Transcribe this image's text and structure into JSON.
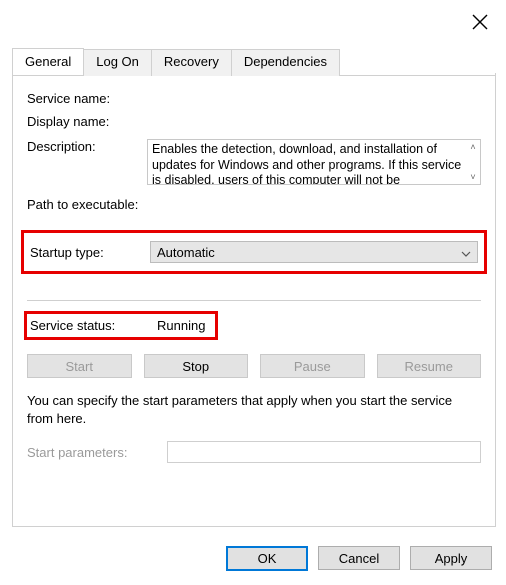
{
  "tabs": {
    "general": "General",
    "logon": "Log On",
    "recovery": "Recovery",
    "dependencies": "Dependencies"
  },
  "labels": {
    "service_name": "Service name:",
    "display_name": "Display name:",
    "description": "Description:",
    "path": "Path to executable:",
    "startup_type": "Startup type:",
    "service_status": "Service status:",
    "start_params": "Start parameters:"
  },
  "values": {
    "description": "Enables the detection, download, and installation of updates for Windows and other programs. If this service is disabled, users of this computer will not be",
    "startup_type": "Automatic",
    "service_status": "Running"
  },
  "buttons": {
    "start": "Start",
    "stop": "Stop",
    "pause": "Pause",
    "resume": "Resume",
    "ok": "OK",
    "cancel": "Cancel",
    "apply": "Apply"
  },
  "note": "You can specify the start parameters that apply when you start the service from here."
}
